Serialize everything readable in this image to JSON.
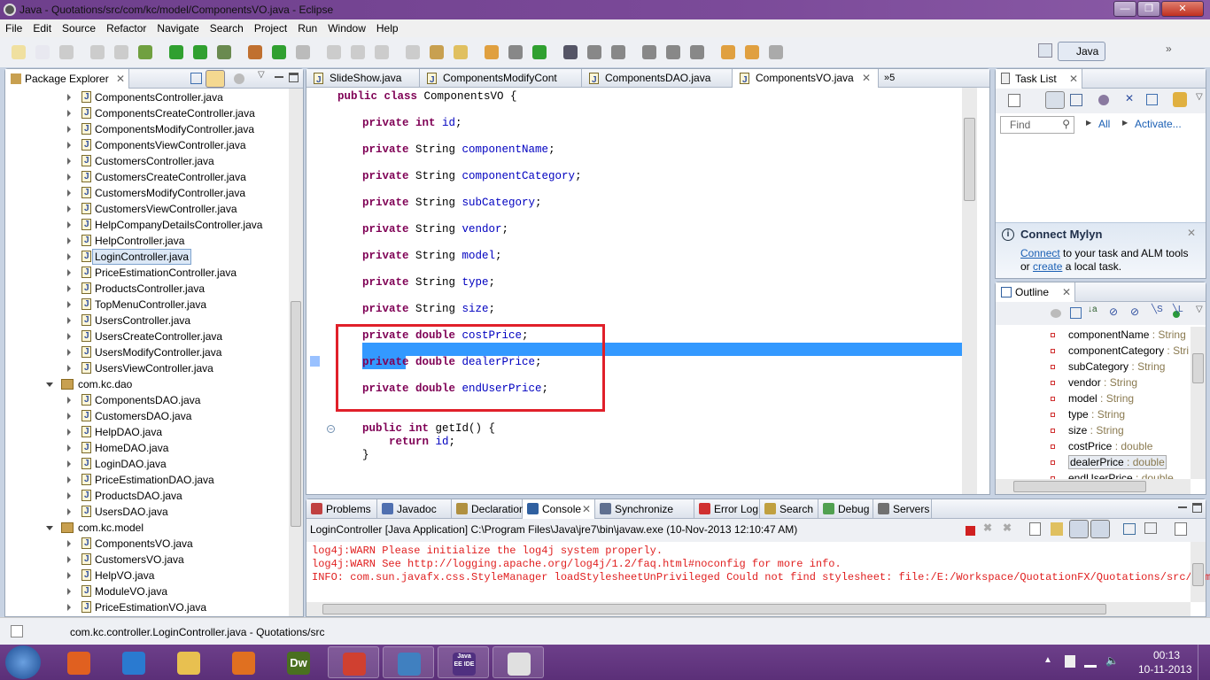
{
  "window": {
    "title": "Java - Quotations/src/com/kc/model/ComponentsVO.java - Eclipse"
  },
  "menu": [
    "File",
    "Edit",
    "Source",
    "Refactor",
    "Navigate",
    "Search",
    "Project",
    "Run",
    "Window",
    "Help"
  ],
  "perspective": {
    "label": "Java"
  },
  "package_explorer": {
    "title": "Package Explorer",
    "rows": [
      {
        "label": "ComponentsController.java",
        "type": "file"
      },
      {
        "label": "ComponentsCreateController.java",
        "type": "file"
      },
      {
        "label": "ComponentsModifyController.java",
        "type": "file"
      },
      {
        "label": "ComponentsViewController.java",
        "type": "file"
      },
      {
        "label": "CustomersController.java",
        "type": "file"
      },
      {
        "label": "CustomersCreateController.java",
        "type": "file"
      },
      {
        "label": "CustomersModifyController.java",
        "type": "file"
      },
      {
        "label": "CustomersViewController.java",
        "type": "file"
      },
      {
        "label": "HelpCompanyDetailsController.java",
        "type": "file"
      },
      {
        "label": "HelpController.java",
        "type": "file"
      },
      {
        "label": "LoginController.java",
        "type": "file",
        "selected": true
      },
      {
        "label": "PriceEstimationController.java",
        "type": "file"
      },
      {
        "label": "ProductsController.java",
        "type": "file"
      },
      {
        "label": "TopMenuController.java",
        "type": "file"
      },
      {
        "label": "UsersController.java",
        "type": "file"
      },
      {
        "label": "UsersCreateController.java",
        "type": "file"
      },
      {
        "label": "UsersModifyController.java",
        "type": "file"
      },
      {
        "label": "UsersViewController.java",
        "type": "file"
      },
      {
        "label": "com.kc.dao",
        "type": "package"
      },
      {
        "label": "ComponentsDAO.java",
        "type": "file"
      },
      {
        "label": "CustomersDAO.java",
        "type": "file"
      },
      {
        "label": "HelpDAO.java",
        "type": "file"
      },
      {
        "label": "HomeDAO.java",
        "type": "file"
      },
      {
        "label": "LoginDAO.java",
        "type": "file"
      },
      {
        "label": "PriceEstimationDAO.java",
        "type": "file"
      },
      {
        "label": "ProductsDAO.java",
        "type": "file"
      },
      {
        "label": "UsersDAO.java",
        "type": "file"
      },
      {
        "label": "com.kc.model",
        "type": "package"
      },
      {
        "label": "ComponentsVO.java",
        "type": "file"
      },
      {
        "label": "CustomersVO.java",
        "type": "file"
      },
      {
        "label": "HelpVO.java",
        "type": "file"
      },
      {
        "label": "ModuleVO.java",
        "type": "file"
      },
      {
        "label": "PriceEstimationVO.java",
        "type": "file"
      }
    ]
  },
  "editor": {
    "tabs": [
      {
        "label": "SlideShow.java"
      },
      {
        "label": "ComponentsModifyCont"
      },
      {
        "label": "ComponentsDAO.java"
      },
      {
        "label": "ComponentsVO.java",
        "active": true
      }
    ],
    "overflow": "5",
    "lines": [
      [
        [
          "kw",
          "public class "
        ],
        [
          "",
          "ComponentsVO {"
        ]
      ],
      [
        [
          "kw",
          "private int "
        ],
        [
          "fd",
          "id"
        ],
        [
          "",
          ";"
        ]
      ],
      [
        [
          "kw",
          "private "
        ],
        [
          "",
          "String "
        ],
        [
          "fd",
          "componentName"
        ],
        [
          "",
          ";"
        ]
      ],
      [
        [
          "kw",
          "private "
        ],
        [
          "",
          "String "
        ],
        [
          "fd",
          "componentCategory"
        ],
        [
          "",
          ";"
        ]
      ],
      [
        [
          "kw",
          "private "
        ],
        [
          "",
          "String "
        ],
        [
          "fd",
          "subCategory"
        ],
        [
          "",
          ";"
        ]
      ],
      [
        [
          "kw",
          "private "
        ],
        [
          "",
          "String "
        ],
        [
          "fd",
          "vendor"
        ],
        [
          "",
          ";"
        ]
      ],
      [
        [
          "kw",
          "private "
        ],
        [
          "",
          "String "
        ],
        [
          "fd",
          "model"
        ],
        [
          "",
          ";"
        ]
      ],
      [
        [
          "kw",
          "private "
        ],
        [
          "",
          "String "
        ],
        [
          "fd",
          "type"
        ],
        [
          "",
          ";"
        ]
      ],
      [
        [
          "kw",
          "private "
        ],
        [
          "",
          "String "
        ],
        [
          "fd",
          "size"
        ],
        [
          "",
          ";"
        ]
      ],
      [
        [
          "kw",
          "private double "
        ],
        [
          "fd",
          "costPrice"
        ],
        [
          "",
          ";"
        ]
      ],
      [
        [
          "kw",
          "private double "
        ],
        [
          "fd",
          "dealerPrice"
        ],
        [
          "",
          ";"
        ]
      ],
      [
        [
          "kw",
          "private double "
        ],
        [
          "fd",
          "endUserPrice"
        ],
        [
          "",
          ";"
        ]
      ],
      [
        [
          "kw",
          "public int "
        ],
        [
          "",
          "getId() {"
        ]
      ],
      [
        [
          "kw",
          "    return "
        ],
        [
          "fd",
          "id"
        ],
        [
          "",
          ";"
        ]
      ],
      [
        [
          "",
          "}"
        ]
      ]
    ],
    "highlight_color": "#3399ff",
    "annotation_color": "#e0202a"
  },
  "task_list": {
    "title": "Task List",
    "find_placeholder": "Find",
    "all": "All",
    "activate": "Activate...",
    "mylyn_title": "Connect Mylyn",
    "mylyn_connect": "Connect",
    "mylyn_text1": " to your task and ALM tools",
    "mylyn_or": "or ",
    "mylyn_create": "create",
    "mylyn_text2": " a local task."
  },
  "outline": {
    "title": "Outline",
    "items": [
      {
        "name": "componentName",
        "type": "String"
      },
      {
        "name": "componentCategory",
        "type": "Stri"
      },
      {
        "name": "subCategory",
        "type": "String"
      },
      {
        "name": "vendor",
        "type": "String"
      },
      {
        "name": "model",
        "type": "String"
      },
      {
        "name": "type",
        "type": "String"
      },
      {
        "name": "size",
        "type": "String"
      },
      {
        "name": "costPrice",
        "type": "double"
      },
      {
        "name": "dealerPrice",
        "type": "double",
        "selected": true
      },
      {
        "name": "endUserPrice",
        "type": "double"
      }
    ]
  },
  "bottom": {
    "tabs": [
      {
        "label": "Problems",
        "color": "#c04040"
      },
      {
        "label": "Javadoc",
        "color": "#5070b0"
      },
      {
        "label": "Declaration",
        "color": "#b09040"
      },
      {
        "label": "Console",
        "color": "#3060a0",
        "active": true
      },
      {
        "label": "Synchronize",
        "color": "#607090"
      },
      {
        "label": "Error Log",
        "color": "#d03030"
      },
      {
        "label": "Search",
        "color": "#c0a040"
      },
      {
        "label": "Debug",
        "color": "#50a050"
      },
      {
        "label": "Servers",
        "color": "#707070"
      }
    ],
    "console_header": "LoginController [Java Application] C:\\Program Files\\Java\\jre7\\bin\\javaw.exe (10-Nov-2013 12:10:47 AM)",
    "console_lines": [
      "log4j:WARN Please initialize the log4j system properly.",
      "log4j:WARN See http://logging.apache.org/log4j/1.2/faq.html#noconfig for more info.",
      "INFO: com.sun.javafx.css.StyleManager loadStylesheetUnPrivileged Could not find stylesheet: file:/E:/Workspace/QuotationFX/Quotations/src/com/"
    ]
  },
  "status": {
    "text": "com.kc.controller.LoginController.java - Quotations/src"
  },
  "taskbar": {
    "time": "00:13",
    "date": "10-11-2013",
    "apps": [
      {
        "name": "media-player",
        "color": "#e06020"
      },
      {
        "name": "internet-explorer",
        "color": "#2a7ad0"
      },
      {
        "name": "file-explorer",
        "color": "#e8c050"
      },
      {
        "name": "firefox",
        "color": "#e07020"
      },
      {
        "name": "dreamweaver",
        "color": "#4a7020",
        "label": "Dw"
      },
      {
        "name": "chrome",
        "color": "#d04030"
      },
      {
        "name": "remote-desktop",
        "color": "#4080c0"
      },
      {
        "name": "eclipse-java-ee",
        "color": "#503080",
        "label": "Java EE IDE"
      },
      {
        "name": "java",
        "color": "#e0e0e0"
      }
    ]
  }
}
